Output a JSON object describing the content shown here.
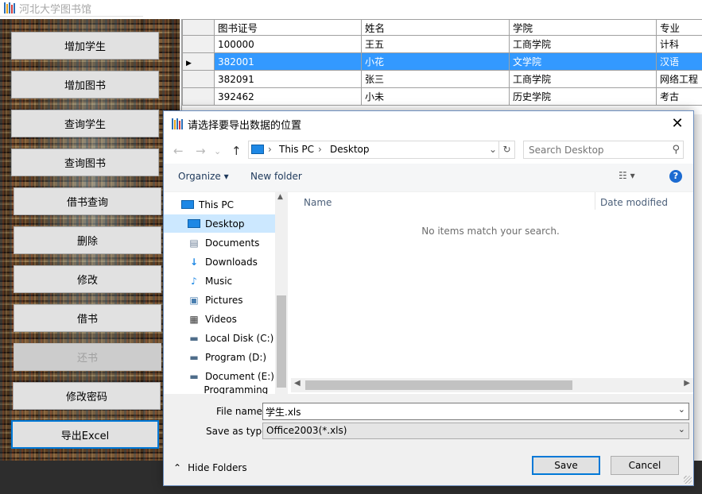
{
  "app": {
    "title": "河北大学图书馆"
  },
  "sidebar": {
    "buttons": [
      {
        "label": "增加学生"
      },
      {
        "label": "增加图书"
      },
      {
        "label": "查询学生"
      },
      {
        "label": "查询图书"
      },
      {
        "label": "借书查询"
      },
      {
        "label": "删除"
      },
      {
        "label": "修改"
      },
      {
        "label": "借书"
      },
      {
        "label": "还书"
      },
      {
        "label": "修改密码"
      },
      {
        "label": "导出Excel"
      }
    ]
  },
  "grid": {
    "columns": [
      "图书证号",
      "姓名",
      "学院",
      "专业"
    ],
    "rows": [
      [
        "100000",
        "王五",
        "工商学院",
        "计科"
      ],
      [
        "382001",
        "小花",
        "文学院",
        "汉语"
      ],
      [
        "382091",
        "张三",
        "工商学院",
        "网络工程"
      ],
      [
        "392462",
        "小未",
        "历史学院",
        "考古"
      ]
    ],
    "selected_row_marker": "▶"
  },
  "dialog": {
    "title": "请选择要导出数据的位置",
    "close_glyph": "✕",
    "address": {
      "crumbs": [
        "This PC",
        "Desktop"
      ]
    },
    "search": {
      "placeholder": "Search Desktop"
    },
    "toolbar": {
      "organize_label": "Organize",
      "new_folder_label": "New folder"
    },
    "tree": [
      {
        "label": "This PC",
        "icon": "computer-icon"
      },
      {
        "label": "Desktop",
        "icon": "desktop-icon",
        "selected": true
      },
      {
        "label": "Documents",
        "icon": "documents-icon"
      },
      {
        "label": "Downloads",
        "icon": "downloads-icon"
      },
      {
        "label": "Music",
        "icon": "music-icon"
      },
      {
        "label": "Pictures",
        "icon": "pictures-icon"
      },
      {
        "label": "Videos",
        "icon": "videos-icon"
      },
      {
        "label": "Local Disk (C:)",
        "icon": "drive-icon"
      },
      {
        "label": "Program (D:)",
        "icon": "drive-icon"
      },
      {
        "label": "Document (E:)",
        "icon": "drive-icon"
      },
      {
        "label": "Programming (F:",
        "icon": "drive-icon"
      }
    ],
    "columns": {
      "name": "Name",
      "date_modified": "Date modified"
    },
    "empty_message": "No items match your search.",
    "file_name": {
      "label": "File name:",
      "value": "学生.xls"
    },
    "save_as_type": {
      "label": "Save as type:",
      "value": "Office2003(*.xls)"
    },
    "hide_folders_label": "Hide Folders",
    "save_label": "Save",
    "cancel_label": "Cancel"
  },
  "colors": {
    "accent": "#0078d7",
    "selection": "#3399ff",
    "tree_selection": "#cce8ff"
  }
}
